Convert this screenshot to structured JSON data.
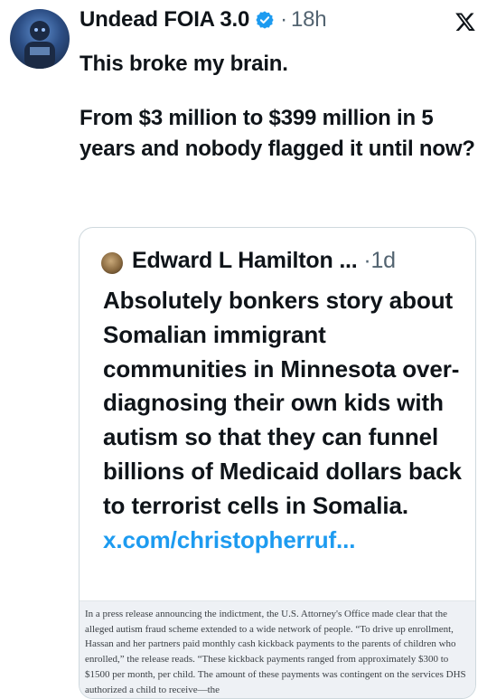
{
  "post": {
    "display_name": "Undead FOIA 3.0",
    "separator": "·",
    "time": "18h",
    "paragraph_1": "This broke my brain.",
    "paragraph_2": "From $3 million to $399 million in 5 years and nobody flagged it until now?"
  },
  "icons": {
    "verified": "verified-badge-icon",
    "platform": "x-logo-icon"
  },
  "quoted_post": {
    "display_name": "Edward L Hamilton",
    "truncation": "...",
    "separator": "·",
    "time": "1d",
    "text": "Absolutely bonkers story about Somalian immigrant communities in Minnesota over-diagnosing their own kids with autism so that they can funnel billions of Medicaid dollars back to terrorist cells in Somalia.",
    "link": "x.com/christopherruf..."
  },
  "attached_document": {
    "text": "In a press release announcing the indictment, the U.S. Attorney's Office made clear that the alleged autism fraud scheme extended to a wide network of people. “To drive up enrollment, Hassan and her partners paid monthly cash kickback payments to the parents of children who enrolled,” the release reads. “These kickback payments ranged from approximately $300 to $1500 per month, per child. The amount of these payments was contingent on the services DHS authorized a child to receive—the"
  },
  "colors": {
    "text": "#0f1419",
    "secondary_text": "#536471",
    "link": "#1d9bf0",
    "border": "#cfd9de"
  }
}
